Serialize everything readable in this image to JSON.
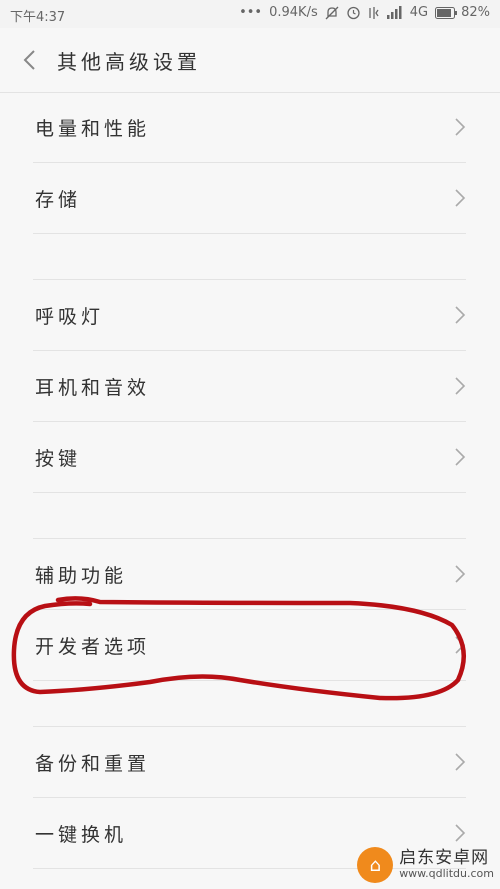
{
  "status_bar": {
    "time": "下午4:37",
    "network_speed": "0.94K/s",
    "network_type": "4G",
    "battery": "82%"
  },
  "header": {
    "title": "其他高级设置",
    "back_icon": "chevron-left-icon"
  },
  "sections": [
    {
      "items": [
        {
          "label": "电量和性能"
        },
        {
          "label": "存储"
        }
      ]
    },
    {
      "items": [
        {
          "label": "呼吸灯"
        },
        {
          "label": "耳机和音效"
        },
        {
          "label": "按键"
        }
      ]
    },
    {
      "items": [
        {
          "label": "辅助功能"
        },
        {
          "label": "开发者选项"
        }
      ]
    },
    {
      "items": [
        {
          "label": "备份和重置"
        },
        {
          "label": "一键换机"
        }
      ]
    }
  ],
  "annotation": {
    "color": "#b80f14",
    "target": "开发者选项"
  },
  "watermark": {
    "name": "启东安卓网",
    "url": "www.qdlitdu.com",
    "accent": "#f08a1c"
  }
}
